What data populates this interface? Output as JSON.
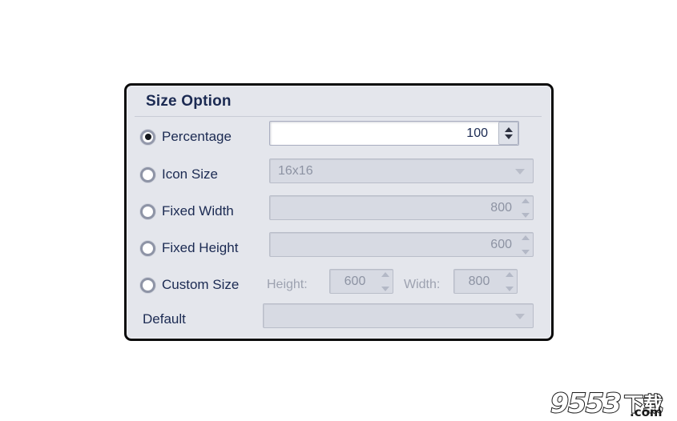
{
  "panel": {
    "title": "Size Option",
    "options": [
      {
        "key": "percentage",
        "label": "Percentage",
        "selected": true,
        "control": "spinbox",
        "enabled": true,
        "value": "100"
      },
      {
        "key": "icon_size",
        "label": "Icon Size",
        "selected": false,
        "control": "combobox",
        "enabled": false,
        "value": "16x16"
      },
      {
        "key": "fixed_width",
        "label": "Fixed Width",
        "selected": false,
        "control": "spinbox",
        "enabled": false,
        "value": "800"
      },
      {
        "key": "fixed_height",
        "label": "Fixed Height",
        "selected": false,
        "control": "spinbox",
        "enabled": false,
        "value": "600"
      },
      {
        "key": "custom_size",
        "label": "Custom Size",
        "selected": false,
        "control": "dual-spinbox",
        "enabled": false,
        "height_label": "Height:",
        "height_value": "600",
        "width_label": "Width:",
        "width_value": "800"
      },
      {
        "key": "default",
        "label": "Default",
        "selected": false,
        "control": "combobox",
        "enabled": false,
        "value": ""
      }
    ]
  },
  "watermark": {
    "digits": "9553",
    "cn": "下载",
    "domain": ".com"
  },
  "colors": {
    "page_background": "#ffffff",
    "panel_background": "#e4e6ec",
    "panel_border": "#0a0a0a",
    "title_text": "#1b2a52",
    "label_text": "#1b2a52",
    "disabled_text": "#8d93a3",
    "field_disabled_bg": "#d7dae3",
    "field_enabled_bg": "#ffffff"
  }
}
